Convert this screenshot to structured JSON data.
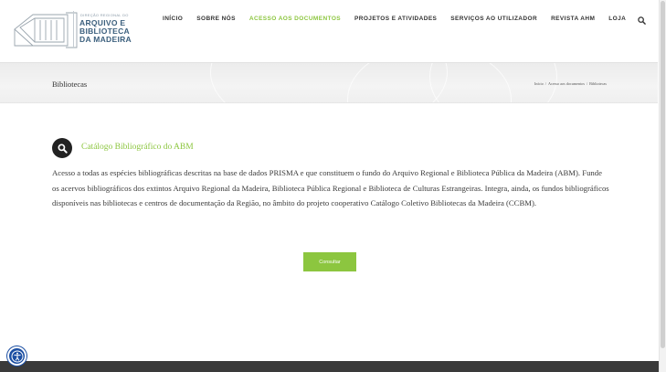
{
  "header": {
    "logo": {
      "small_text": "DIREÇÃO REGIONAL DO",
      "lines": [
        "ARQUIVO E",
        "BIBLIOTECA",
        "DA MADEIRA"
      ]
    },
    "nav": [
      {
        "label": "INÍCIO",
        "active": false
      },
      {
        "label": "SOBRE NÓS",
        "active": false
      },
      {
        "label": "ACESSO AOS DOCUMENTOS",
        "active": true
      },
      {
        "label": "PROJETOS E ATIVIDADES",
        "active": false
      },
      {
        "label": "SERVIÇOS AO UTILIZADOR",
        "active": false
      },
      {
        "label": "REVISTA AHM",
        "active": false
      },
      {
        "label": "LOJA",
        "active": false
      }
    ],
    "search_icon": "search-icon"
  },
  "titlebar": {
    "title": "Bibliotecas",
    "breadcrumb": [
      "Início",
      "Acesso aos documentos",
      "Bibliotecas"
    ],
    "breadcrumb_sep": "/"
  },
  "content": {
    "icon": "search-icon",
    "section_title": "Catálogo Bibliográfico do ABM",
    "body": "Acesso a todas as espécies bibliográficas descritas na base de dados PRISMA e que constituem o fundo do Arquivo Regional e Biblioteca Pública da Madeira (ABM).  Funde os acervos bibliográficos dos extintos Arquivo Regional da Madeira, Biblioteca Pública Regional e Biblioteca de Culturas Estrangeiras. Integra, ainda, os fundos bibliográficos disponíveis nas bibliotecas e centros de documentação da Região, no âmbito do projeto cooperativo Catálogo Coletivo Bibliotecas da Madeira (CCBM).",
    "button_label": "Consultar"
  },
  "colors": {
    "accent": "#8cc63f",
    "brand_blue": "#3b5f7d",
    "accessibility": "#1c4fa3",
    "footer": "#3a3a3a"
  },
  "accessibility_icon": "accessibility-icon"
}
